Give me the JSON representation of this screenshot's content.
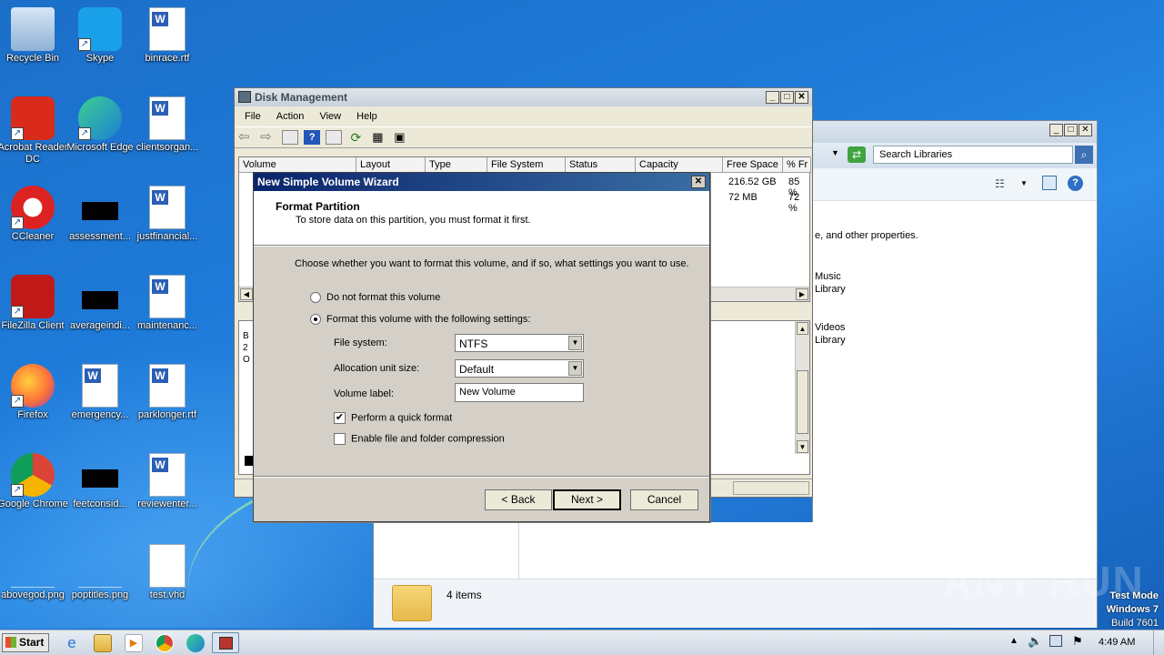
{
  "desktop_icons": [
    {
      "label": "Recycle Bin",
      "icon": "recycle-bin-icon"
    },
    {
      "label": "Skype",
      "icon": "skype-icon"
    },
    {
      "label": "binrace.rtf",
      "icon": "word-doc-icon"
    },
    {
      "label": "Acrobat Reader DC",
      "icon": "acrobat-icon"
    },
    {
      "label": "Microsoft Edge",
      "icon": "edge-icon"
    },
    {
      "label": "clientsorgan...",
      "icon": "word-doc-icon"
    },
    {
      "label": "CCleaner",
      "icon": "ccleaner-icon"
    },
    {
      "label": "assessment...",
      "icon": "file-icon"
    },
    {
      "label": "justfinancial...",
      "icon": "word-doc-icon"
    },
    {
      "label": "FileZilla Client",
      "icon": "filezilla-icon"
    },
    {
      "label": "averageindi...",
      "icon": "file-icon"
    },
    {
      "label": "maintenanc...",
      "icon": "word-doc-icon"
    },
    {
      "label": "Firefox",
      "icon": "firefox-icon"
    },
    {
      "label": "emergency...",
      "icon": "word-doc-icon"
    },
    {
      "label": "parklonger.rtf",
      "icon": "word-doc-icon"
    },
    {
      "label": "Google Chrome",
      "icon": "chrome-icon"
    },
    {
      "label": "feetconsid...",
      "icon": "file-icon"
    },
    {
      "label": "reviewenter...",
      "icon": "word-doc-icon"
    },
    {
      "label": "abovegod.png",
      "icon": "image-icon"
    },
    {
      "label": "poptitles.png",
      "icon": "image-icon"
    },
    {
      "label": "test.vhd",
      "icon": "blank-file-icon"
    }
  ],
  "libraries_window": {
    "search_placeholder": "Search Libraries",
    "description_text": "e, and other properties.",
    "items": [
      {
        "line1": "Music",
        "line2": "Library"
      },
      {
        "line1": "Videos",
        "line2": "Library"
      }
    ],
    "status_text": "4 items"
  },
  "disk_management": {
    "title": "Disk Management",
    "menu": [
      "File",
      "Action",
      "View",
      "Help"
    ],
    "columns": [
      "Volume",
      "Layout",
      "Type",
      "File System",
      "Status",
      "Capacity",
      "Free Space",
      "% Fr"
    ],
    "rows": [
      {
        "free_space": "216.52 GB",
        "pct_free": "85 %"
      },
      {
        "free_space": "72 MB",
        "pct_free": "72 %"
      }
    ],
    "lower_pane_text": [
      "B",
      "2",
      "O"
    ]
  },
  "wizard": {
    "title": "New Simple Volume Wizard",
    "header_title": "Format Partition",
    "header_subtitle": "To store data on this partition, you must format it first.",
    "instruction": "Choose whether you want to format this volume, and if so, what settings you want to use.",
    "option_no_format": "Do not format this volume",
    "option_format": "Format this volume with the following settings:",
    "file_system_label": "File system:",
    "file_system_value": "NTFS",
    "alloc_label": "Allocation unit size:",
    "alloc_value": "Default",
    "volume_label_label": "Volume label:",
    "volume_label_value": "New Volume",
    "quick_format_label": "Perform a quick format",
    "compression_label": "Enable file and folder compression",
    "back_button": "< Back",
    "next_button": "Next >",
    "cancel_button": "Cancel"
  },
  "watermark": {
    "line1": "Test Mode",
    "line2": "Windows 7",
    "line3": "Build 7601",
    "brand": "ANY RUN"
  },
  "taskbar": {
    "start_label": "Start",
    "clock": "4:49 AM"
  }
}
